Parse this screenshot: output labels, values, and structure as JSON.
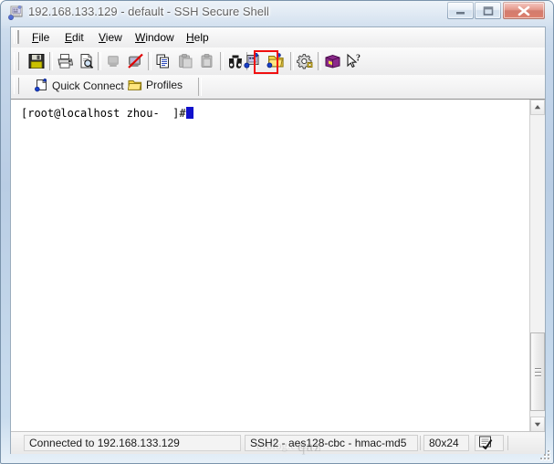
{
  "window": {
    "title": "192.168.133.129 - default - SSH Secure Shell",
    "app_icon": "ssh-app-icon",
    "caption": {
      "minimize_label": "Minimize",
      "maximize_label": "Maximize",
      "close_label": "Close"
    }
  },
  "menubar": {
    "items": [
      {
        "label": "File",
        "mnemonic": "F"
      },
      {
        "label": "Edit",
        "mnemonic": "E"
      },
      {
        "label": "View",
        "mnemonic": "V"
      },
      {
        "label": "Window",
        "mnemonic": "W"
      },
      {
        "label": "Help",
        "mnemonic": "H"
      }
    ]
  },
  "toolbar": {
    "buttons": [
      {
        "name": "save-icon",
        "tooltip": "Save",
        "enabled": true
      },
      {
        "name": "print-icon",
        "tooltip": "Print",
        "enabled": true
      },
      {
        "name": "print-preview-icon",
        "tooltip": "Print Preview",
        "enabled": true
      },
      {
        "name": "connect-icon",
        "tooltip": "Connect",
        "enabled": false
      },
      {
        "name": "disconnect-icon",
        "tooltip": "Disconnect",
        "enabled": true
      },
      {
        "name": "copy-icon",
        "tooltip": "Copy",
        "enabled": true
      },
      {
        "name": "paste-icon",
        "tooltip": "Paste",
        "enabled": false
      },
      {
        "name": "paste-alt-icon",
        "tooltip": "Paste",
        "enabled": false
      },
      {
        "name": "find-icon",
        "tooltip": "Find",
        "enabled": true
      },
      {
        "name": "new-terminal-icon",
        "tooltip": "New Terminal Window",
        "enabled": true
      },
      {
        "name": "file-transfer-icon",
        "tooltip": "New File Transfer Window",
        "enabled": true,
        "highlighted": true
      },
      {
        "name": "settings-icon",
        "tooltip": "Settings",
        "enabled": true
      },
      {
        "name": "help-book-icon",
        "tooltip": "Help",
        "enabled": true
      },
      {
        "name": "context-help-icon",
        "tooltip": "Context Help",
        "enabled": true
      }
    ],
    "highlight_color": "#f01010"
  },
  "toolbar2": {
    "quick_connect_label": "Quick Connect",
    "profiles_label": "Profiles"
  },
  "terminal": {
    "prompt_text": "[root@localhost zhou-  ]#",
    "cursor": "block",
    "cursor_color": "#1111cc",
    "background": "#ffffff",
    "foreground": "#000000"
  },
  "scrollbar": {
    "up_arrow": "scroll-up-arrow",
    "down_arrow": "scroll-down-arrow",
    "thumb_position": "bottom"
  },
  "statusbar": {
    "connection": "Connected to 192.168.133.129",
    "cipher": "SSH2 - aes128-cbc - hmac-md5",
    "size": "80x24",
    "encoding_icon": "encoding-icon",
    "blank": ""
  },
  "watermark": {
    "text_main": "qaz",
    "text_faint": "t//blog.csdn.n"
  }
}
